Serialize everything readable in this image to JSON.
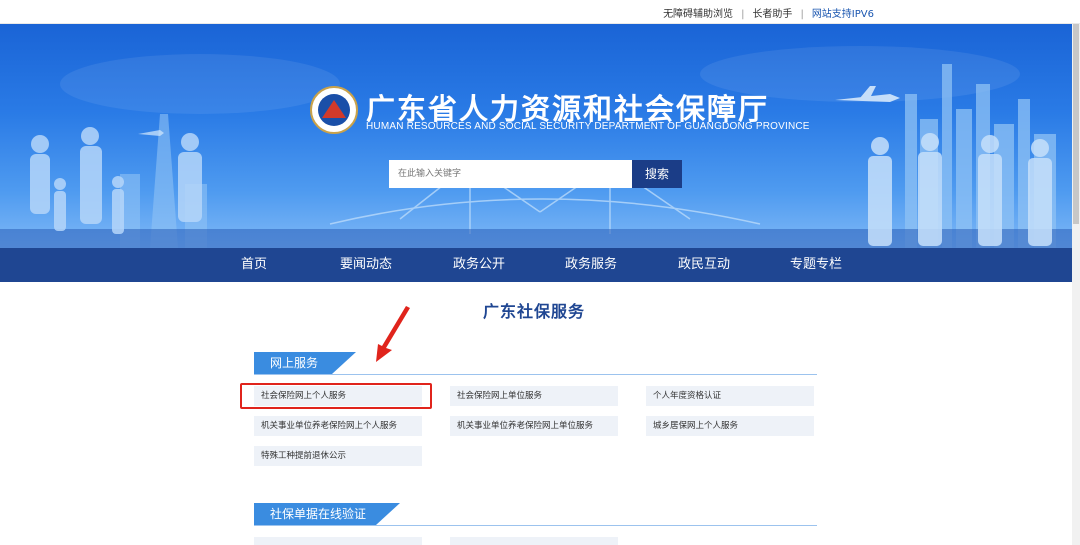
{
  "topbar": {
    "links": [
      "无障碍辅助浏览",
      "长者助手",
      "网站支持IPV6"
    ]
  },
  "header": {
    "title": "广东省人力资源和社会保障厅",
    "subtitle": "HUMAN RESOURCES AND SOCIAL SECURITY DEPARTMENT OF GUANGDONG PROVINCE",
    "emblem_icon": "department-emblem-icon"
  },
  "search": {
    "placeholder": "在此输入关键字",
    "button_label": "搜索"
  },
  "nav": {
    "items": [
      "首页",
      "要闻动态",
      "政务公开",
      "政务服务",
      "政民互动",
      "专题专栏"
    ]
  },
  "main": {
    "heading": "广东社保服务",
    "sections": [
      {
        "title": "网上服务",
        "services": [
          "社会保险网上个人服务",
          "社会保险网上单位服务",
          "个人年度资格认证",
          "机关事业单位养老保险网上个人服务",
          "机关事业单位养老保险网上单位服务",
          "城乡居保网上个人服务",
          "特殊工种提前退休公示"
        ]
      },
      {
        "title": "社保单据在线验证",
        "services": []
      }
    ]
  },
  "colors": {
    "nav_bg": "#1f4692",
    "accent_blue": "#3a8ce0",
    "highlight_red": "#e0241c",
    "search_button": "#1b3d87"
  }
}
